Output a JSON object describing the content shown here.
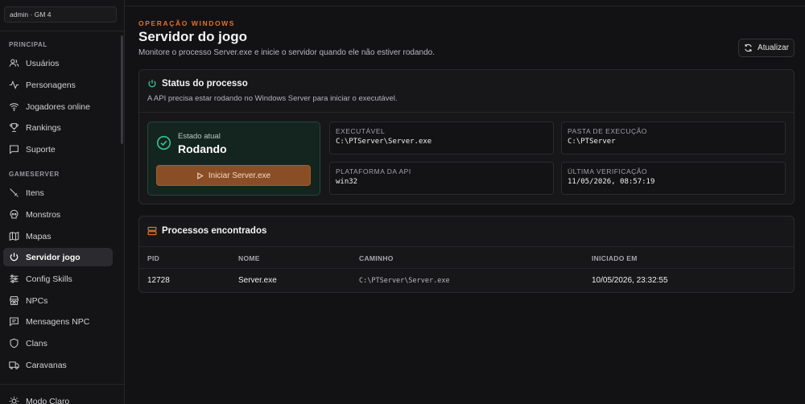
{
  "sidebar": {
    "user": "admin · GM 4",
    "sections": [
      {
        "label": "PRINCIPAL"
      },
      {
        "label": "GAMESERVER"
      }
    ],
    "items": [
      {
        "label": "Usuários",
        "icon": "users-icon"
      },
      {
        "label": "Personagens",
        "icon": "activity-icon"
      },
      {
        "label": "Jogadores online",
        "icon": "wifi-icon"
      },
      {
        "label": "Rankings",
        "icon": "trophy-icon"
      },
      {
        "label": "Suporte",
        "icon": "message-icon"
      },
      {
        "label": "Itens",
        "icon": "sword-icon"
      },
      {
        "label": "Monstros",
        "icon": "skull-icon"
      },
      {
        "label": "Mapas",
        "icon": "map-icon"
      },
      {
        "label": "Servidor jogo",
        "icon": "power-icon",
        "active": true
      },
      {
        "label": "Config Skills",
        "icon": "sliders-icon"
      },
      {
        "label": "NPCs",
        "icon": "store-icon"
      },
      {
        "label": "Mensagens NPC",
        "icon": "chat-icon"
      },
      {
        "label": "Clans",
        "icon": "shield-icon"
      },
      {
        "label": "Caravanas",
        "icon": "truck-icon"
      }
    ],
    "theme_toggle": "Modo Claro"
  },
  "header": {
    "eyebrow": "OPERAÇÃO WINDOWS",
    "title": "Servidor do jogo",
    "subtitle": "Monitore o processo Server.exe e inicie o servidor quando ele não estiver rodando.",
    "refresh_label": "Atualizar"
  },
  "status_card": {
    "title": "Status do processo",
    "subtitle": "A API precisa estar rodando no Windows Server para iniciar o executável.",
    "state_label": "Estado atual",
    "state_value": "Rodando",
    "start_button": "Iniciar Server.exe",
    "info": [
      {
        "label": "EXECUTÁVEL",
        "value": "C:\\PTServer\\Server.exe"
      },
      {
        "label": "PASTA DE EXECUÇÃO",
        "value": "C:\\PTServer"
      },
      {
        "label": "PLATAFORMA DA API",
        "value": "win32"
      },
      {
        "label": "ÚLTIMA VERIFICAÇÃO",
        "value": "11/05/2026, 08:57:19"
      }
    ]
  },
  "process_card": {
    "title": "Processos encontrados",
    "columns": [
      "PID",
      "NOME",
      "CAMINHO",
      "INICIADO EM"
    ],
    "rows": [
      {
        "pid": "12728",
        "name": "Server.exe",
        "path": "C:\\PTServer\\Server.exe",
        "started": "10/05/2026, 23:32:55"
      }
    ]
  },
  "colors": {
    "accent": "#e0722f",
    "success": "#34c38f",
    "start_button": "#8a4e26",
    "background": "#121214"
  }
}
